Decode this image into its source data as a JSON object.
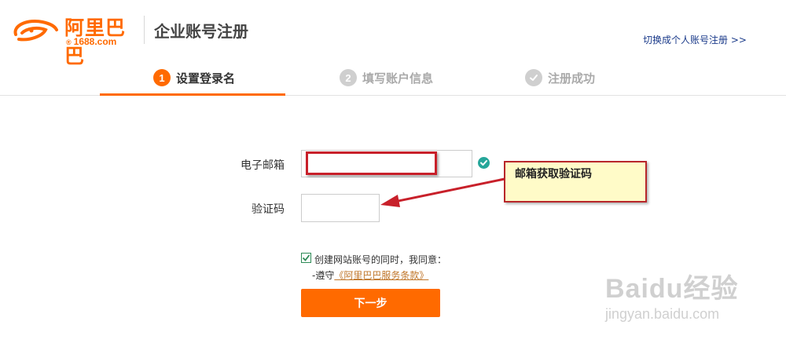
{
  "header": {
    "logo_text": "阿里巴巴",
    "logo_domain": "1688.com",
    "logo_reg": "®",
    "title": "企业账号注册",
    "switch_link": "切换成个人账号注册  >>"
  },
  "steps": [
    {
      "number": "1",
      "label": "设置登录名",
      "state": "active"
    },
    {
      "number": "2",
      "label": "填写账户信息",
      "state": "inactive"
    },
    {
      "number": "",
      "label": "注册成功",
      "state": "inactive"
    }
  ],
  "form": {
    "email_label": "电子邮箱",
    "email_value": "",
    "code_label": "验证码",
    "code_value": "",
    "agreement_checked": true,
    "agreement_text": "创建网站账号的同时，我同意：",
    "agreement_prefix": "-遵守",
    "terms_link": "《阿里巴巴服务条款》",
    "next_button": "下一步"
  },
  "annotation": {
    "callout_text": "邮箱获取验证码"
  },
  "watermark": {
    "main": "Baidu经验",
    "url": "jingyan.baidu.com"
  },
  "colors": {
    "accent": "#ff6a00",
    "success": "#26a69a",
    "annotation_border": "#c8202a",
    "callout_bg": "#fffbc8",
    "link": "#1a3a8a"
  },
  "icons": {
    "step3": "check-circle-icon",
    "email_valid": "check-circle-icon",
    "checkbox": "checkmark-icon"
  }
}
